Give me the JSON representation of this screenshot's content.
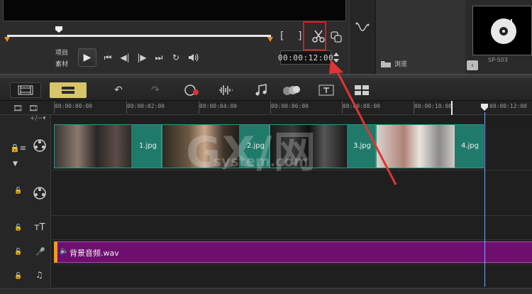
{
  "player": {
    "label_project": "项目",
    "label_clip": "素材",
    "timecode": "00:00:12:00",
    "mark_in": "[",
    "mark_out": "]"
  },
  "library": {
    "browse_label": "浏览",
    "thumb_label": "SP-S03"
  },
  "ruler": {
    "ticks": [
      "00:00:00:00",
      "00:00:02:00",
      "00:00:04:00",
      "00:00:06:00",
      "00:00:08:00",
      "00:00:10:00",
      "00:00:12:00"
    ]
  },
  "video_clips": [
    {
      "label": "1.jpg"
    },
    {
      "label": "2.jpg"
    },
    {
      "label": "3.jpg"
    },
    {
      "label": "4.jpg"
    }
  ],
  "audio_clip": {
    "label": "背景音频.wav"
  },
  "watermark": {
    "main": "GX/网",
    "sub": "system.com"
  },
  "colors": {
    "highlight": "#e0171f",
    "annotation_arrow": "#e03434",
    "clip_video": "#1f7a6a",
    "clip_audio": "#6e0f70",
    "trim_marker": "#f08a24",
    "timeline_button": "#d8c56b"
  },
  "icons": {
    "split": "scissors-icon",
    "play": "play-icon",
    "undo": "undo-icon",
    "redo": "redo-icon"
  }
}
